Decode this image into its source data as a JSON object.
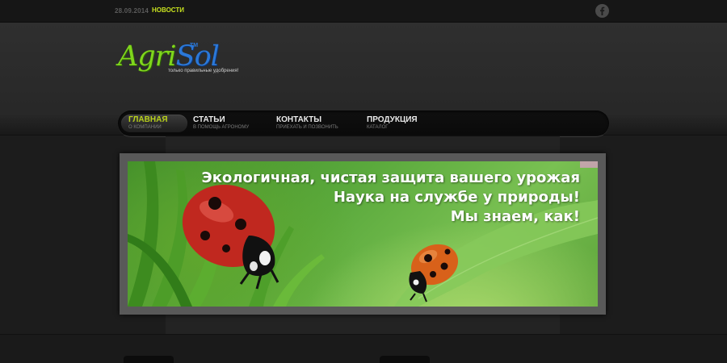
{
  "topbar": {
    "date": "28.09.2014",
    "news_label": "НОВОСТИ",
    "social_icon": "facebook-icon"
  },
  "logo": {
    "part1": "Agri",
    "part2": "Sol",
    "tm": "TM",
    "slogan": "только правильные удобрения!"
  },
  "nav": {
    "items": [
      {
        "title": "ГЛАВНАЯ",
        "subtitle": "О КОМПАНИИ",
        "active": true
      },
      {
        "title": "СТАТЬИ",
        "subtitle": "В ПОМОЩЬ АГРОНОМУ",
        "active": false
      },
      {
        "title": "КОНТАКТЫ",
        "subtitle": "ПРИЕХАТЬ И ПОЗВОНИТЬ",
        "active": false
      },
      {
        "title": "ПРОДУКЦИЯ",
        "subtitle": "КАТАЛОГ",
        "active": false
      }
    ]
  },
  "banner": {
    "line1": "Экологичная, чистая защита вашего урожая",
    "line2": "Наука на службе у природы!",
    "line3": "Мы знаем, как!"
  },
  "colors": {
    "accent": "#c8e21f",
    "logo_green": "#7fd61c",
    "logo_blue": "#2b78d8"
  }
}
